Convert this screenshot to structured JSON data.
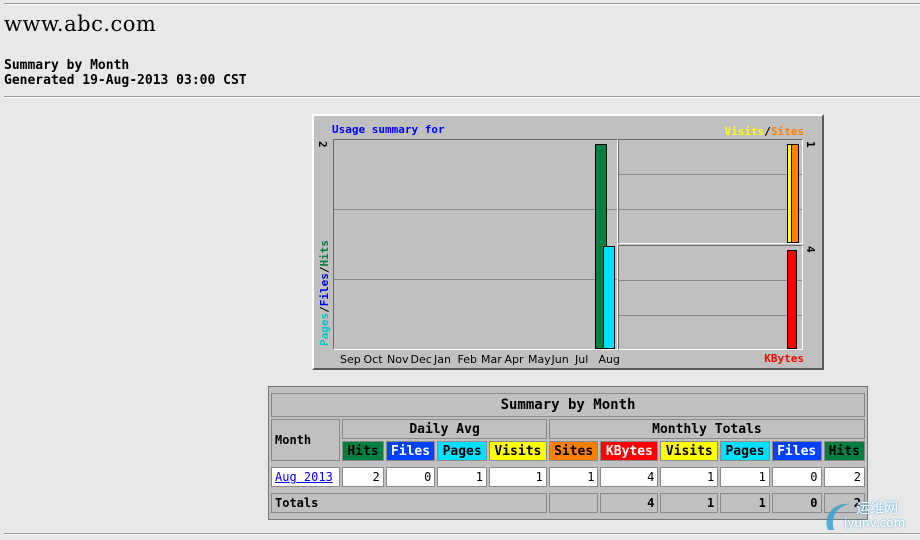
{
  "header": {
    "site_title": "www.abc.com",
    "summary_title": "Summary by Month",
    "generated": "Generated 19-Aug-2013 03:00 CST"
  },
  "graph": {
    "title": "Usage summary for",
    "legend_visits": "Visits",
    "legend_sep": "/",
    "legend_sites": "Sites",
    "legend_pages": "Pages",
    "legend_files": "Files",
    "legend_hits": "Hits",
    "kbytes_label": "KBytes",
    "main_max_tick": "2",
    "upper_max_tick": "1",
    "lower_max_tick": "4",
    "months": [
      "Sep",
      "Oct",
      "Nov",
      "Dec",
      "Jan",
      "Feb",
      "Mar",
      "Apr",
      "May",
      "Jun",
      "Jul",
      "Aug"
    ],
    "colors": {
      "hits": "#008040",
      "files": "#0000ff",
      "pages": "#00e0ff",
      "visits": "#ffff00",
      "sites": "#ff8000",
      "kbytes": "#ff0000"
    }
  },
  "chart_data": {
    "type": "bar",
    "categories": [
      "Sep",
      "Oct",
      "Nov",
      "Dec",
      "Jan",
      "Feb",
      "Mar",
      "Apr",
      "May",
      "Jun",
      "Jul",
      "Aug"
    ],
    "series": [
      {
        "name": "Hits",
        "values": [
          0,
          0,
          0,
          0,
          0,
          0,
          0,
          0,
          0,
          0,
          0,
          2
        ]
      },
      {
        "name": "Files",
        "values": [
          0,
          0,
          0,
          0,
          0,
          0,
          0,
          0,
          0,
          0,
          0,
          0
        ]
      },
      {
        "name": "Pages",
        "values": [
          0,
          0,
          0,
          0,
          0,
          0,
          0,
          0,
          0,
          0,
          0,
          1
        ]
      },
      {
        "name": "Visits",
        "values": [
          0,
          0,
          0,
          0,
          0,
          0,
          0,
          0,
          0,
          0,
          0,
          1
        ]
      },
      {
        "name": "Sites",
        "values": [
          0,
          0,
          0,
          0,
          0,
          0,
          0,
          0,
          0,
          0,
          0,
          1
        ]
      },
      {
        "name": "KBytes",
        "values": [
          0,
          0,
          0,
          0,
          0,
          0,
          0,
          0,
          0,
          0,
          0,
          4
        ]
      }
    ],
    "title": "Usage summary for",
    "ylim_hits": [
      0,
      2
    ],
    "ylim_visits_sites": [
      0,
      1
    ],
    "ylim_kbytes": [
      0,
      4
    ],
    "grid": true
  },
  "table": {
    "title": "Summary by Month",
    "month_header": "Month",
    "daily_avg_header": "Daily Avg",
    "monthly_totals_header": "Monthly Totals",
    "daily_cols": [
      "Hits",
      "Files",
      "Pages",
      "Visits"
    ],
    "monthly_cols": [
      "Sites",
      "KBytes",
      "Visits",
      "Pages",
      "Files",
      "Hits"
    ],
    "rows": [
      {
        "month": "Aug 2013",
        "daily": [
          "2",
          "0",
          "1",
          "1"
        ],
        "monthly": [
          "1",
          "4",
          "1",
          "1",
          "0",
          "2"
        ]
      }
    ],
    "totals_label": "Totals",
    "totals": [
      "4",
      "1",
      "1",
      "0",
      "2"
    ]
  },
  "watermark": {
    "brand": "运维网",
    "domain": "iyunv.com"
  }
}
